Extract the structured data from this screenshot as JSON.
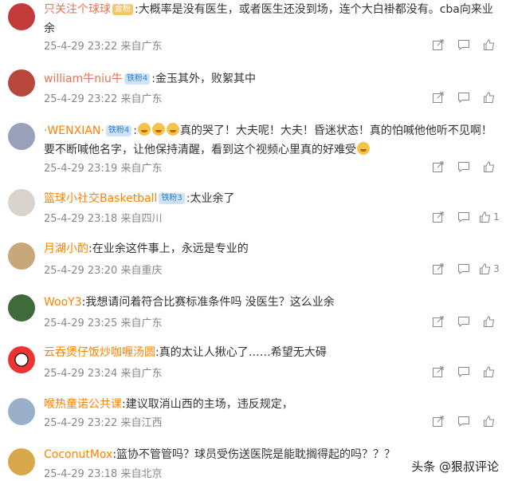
{
  "comments": [
    {
      "user": "只关注个球球",
      "badge": "金粉",
      "badge_style": "gold",
      "text": ":大概率是没有医生，或者医生还没到场，连个大白褂都没有。cba向来业余",
      "time": "25-4-29 23:22",
      "loc": "来自广东",
      "likes": ""
    },
    {
      "user": "william牛niu牛",
      "badge": "铁粉4",
      "text": ":金玉其外，败絮其中",
      "time": "25-4-29 23:22",
      "loc": "来自广东",
      "likes": ""
    },
    {
      "user": "·WENXIAN·",
      "badge": "铁粉4",
      "text": "真的哭了！大夫呢！大夫！昏迷状态！真的怕喊他他听不见啊！要不断喊他名字，让他保持清醒，看到这个视频心里真的好难受",
      "time": "25-4-29 23:19",
      "loc": "来自广东",
      "likes": ""
    },
    {
      "user": "篮球小社交Basketball",
      "badge": "铁粉3",
      "text": ":太业余了",
      "time": "25-4-29 23:18",
      "loc": "来自四川",
      "likes": "1"
    },
    {
      "user": "月湖小酌",
      "badge": "",
      "text": ":在业余这件事上，永远是专业的",
      "time": "25-4-29 23:20",
      "loc": "来自重庆",
      "likes": "3"
    },
    {
      "user": "WooY3",
      "badge": "",
      "text": ":我想请问着符合比赛标准条件吗 没医生？这么业余",
      "time": "25-4-29 23:25",
      "loc": "来自广东",
      "likes": ""
    },
    {
      "user": "云吞煲仔饭炒咖喱汤圆",
      "badge": "",
      "text": ":真的太让人揪心了……希望无大碍",
      "time": "25-4-29 23:24",
      "loc": "来自广东",
      "likes": ""
    },
    {
      "user": "喉热童诺公共课",
      "badge": "",
      "text": ":建议取消山西的主场，违反规定，",
      "time": "25-4-29 23:22",
      "loc": "来自江西",
      "likes": ""
    },
    {
      "user": "CoconutMox",
      "badge": "",
      "text": ":篮协不管管吗？球员受伤送医院是能耽搁得起的吗？？？",
      "time": "25-4-29 23:18",
      "loc": "来自北京",
      "likes": ""
    }
  ],
  "watermark": "头条 @狠叔评论",
  "colors": {
    "username": "#eb7350",
    "meta": "#888888",
    "badge_bg": "#cfe3f7"
  }
}
